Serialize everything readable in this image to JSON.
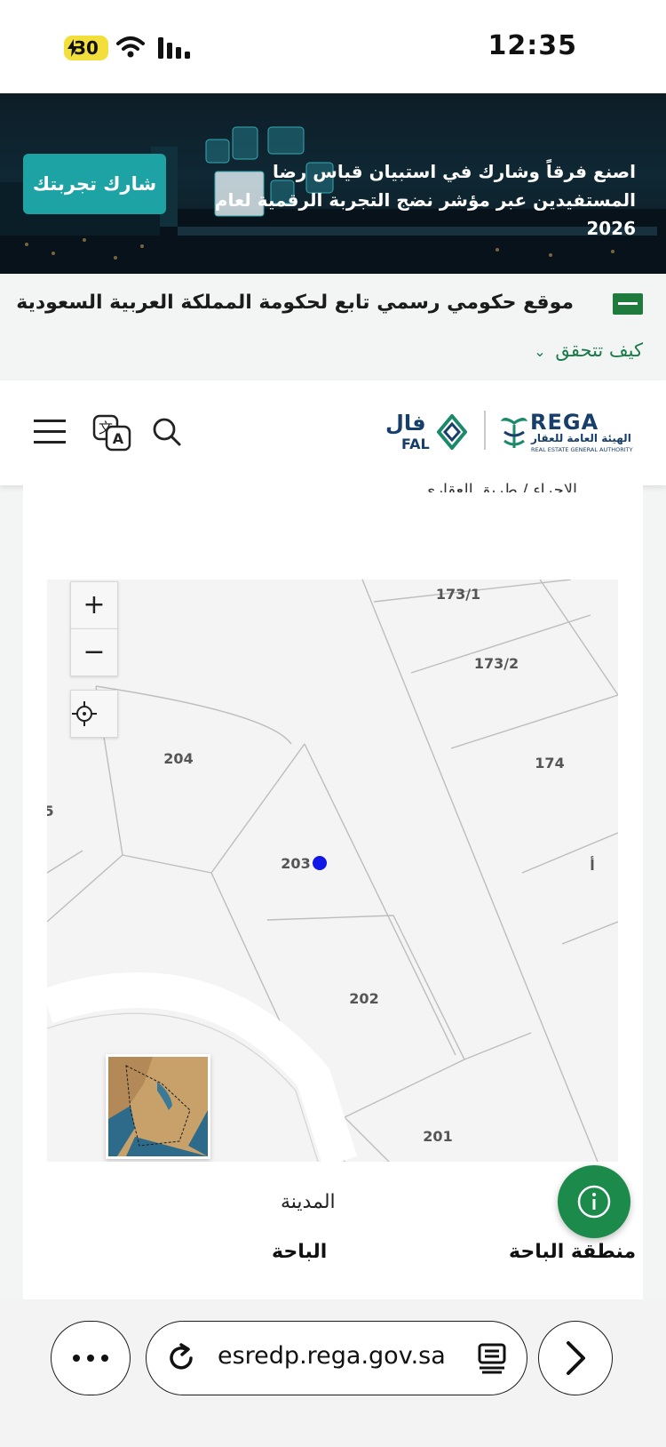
{
  "status_bar": {
    "battery": "30",
    "time": "12:35"
  },
  "banner": {
    "text": "اصنع فرقاً وشارك في استبيان قياس رضا المستفيدين عبر مؤشر نضج التجربة الرقمية لعام 2026",
    "cta_label": "شارك تجربتك"
  },
  "gov_notice": {
    "title": "موقع حكومي رسمي تابع لحكومة المملكة العربية السعودية",
    "verify_link": "كيف تتحقق"
  },
  "header": {
    "rega_name": "REGA",
    "rega_arabic": "الهيئة العامة للعقار",
    "rega_english": "REAL ESTATE GENERAL AUTHORITY",
    "fal_arabic": "فال",
    "fal_english": "FAL"
  },
  "content": {
    "cut_off_text": "الإجراء / طريق العقاري"
  },
  "map": {
    "zoom_in": "+",
    "zoom_out": "−",
    "parcels": [
      "173/1",
      "173/2",
      "174",
      "204",
      "5",
      "203",
      "202",
      "201",
      "أ"
    ],
    "marker_color": "#1016e8"
  },
  "details": {
    "city_label": "المدينة",
    "city_value": "الباحة",
    "region_label": "منطقة الباحة"
  },
  "browser": {
    "url": "esredp.rega.gov.sa"
  }
}
